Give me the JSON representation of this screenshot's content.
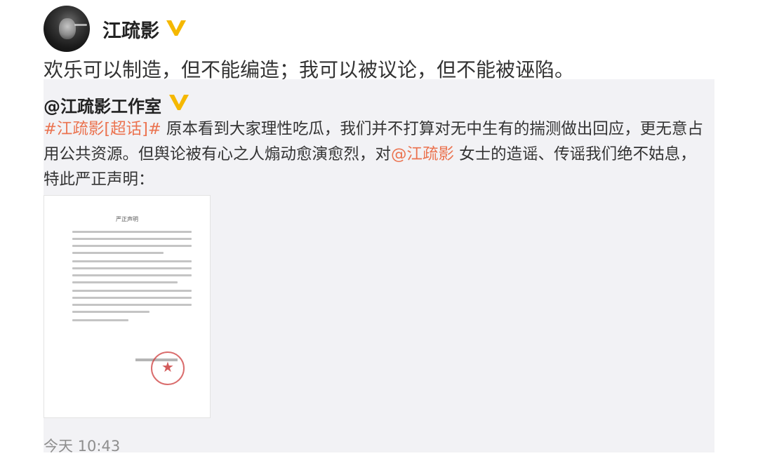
{
  "post": {
    "author": "江疏影",
    "verified_icon": "vip-v-icon",
    "text": "欢乐可以制造，但不能编造；我可以被议论，但不能被诬陷。"
  },
  "repost": {
    "author": "@江疏影工作室",
    "verified_icon": "vip-v-icon",
    "body": {
      "tag": "#江疏影[超话]#",
      "part1": " 原本看到大家理性吃瓜，我们并不打算对无中生有的揣测做出回应，更无意占用公共资源。但舆论被有心之人煽动愈演愈烈，对",
      "mention": "@江疏影",
      "part2": " 女士的造谣、传谣我们绝不姑息，特此严正声明："
    },
    "attachment": {
      "doc_title": "严正声明"
    },
    "timestamp": "今天 10:43"
  },
  "colors": {
    "accent_link": "#eb7350",
    "badge_gold": "#f5b800",
    "repost_bg": "#f2f2f5",
    "muted_text": "#8e8e8e"
  }
}
